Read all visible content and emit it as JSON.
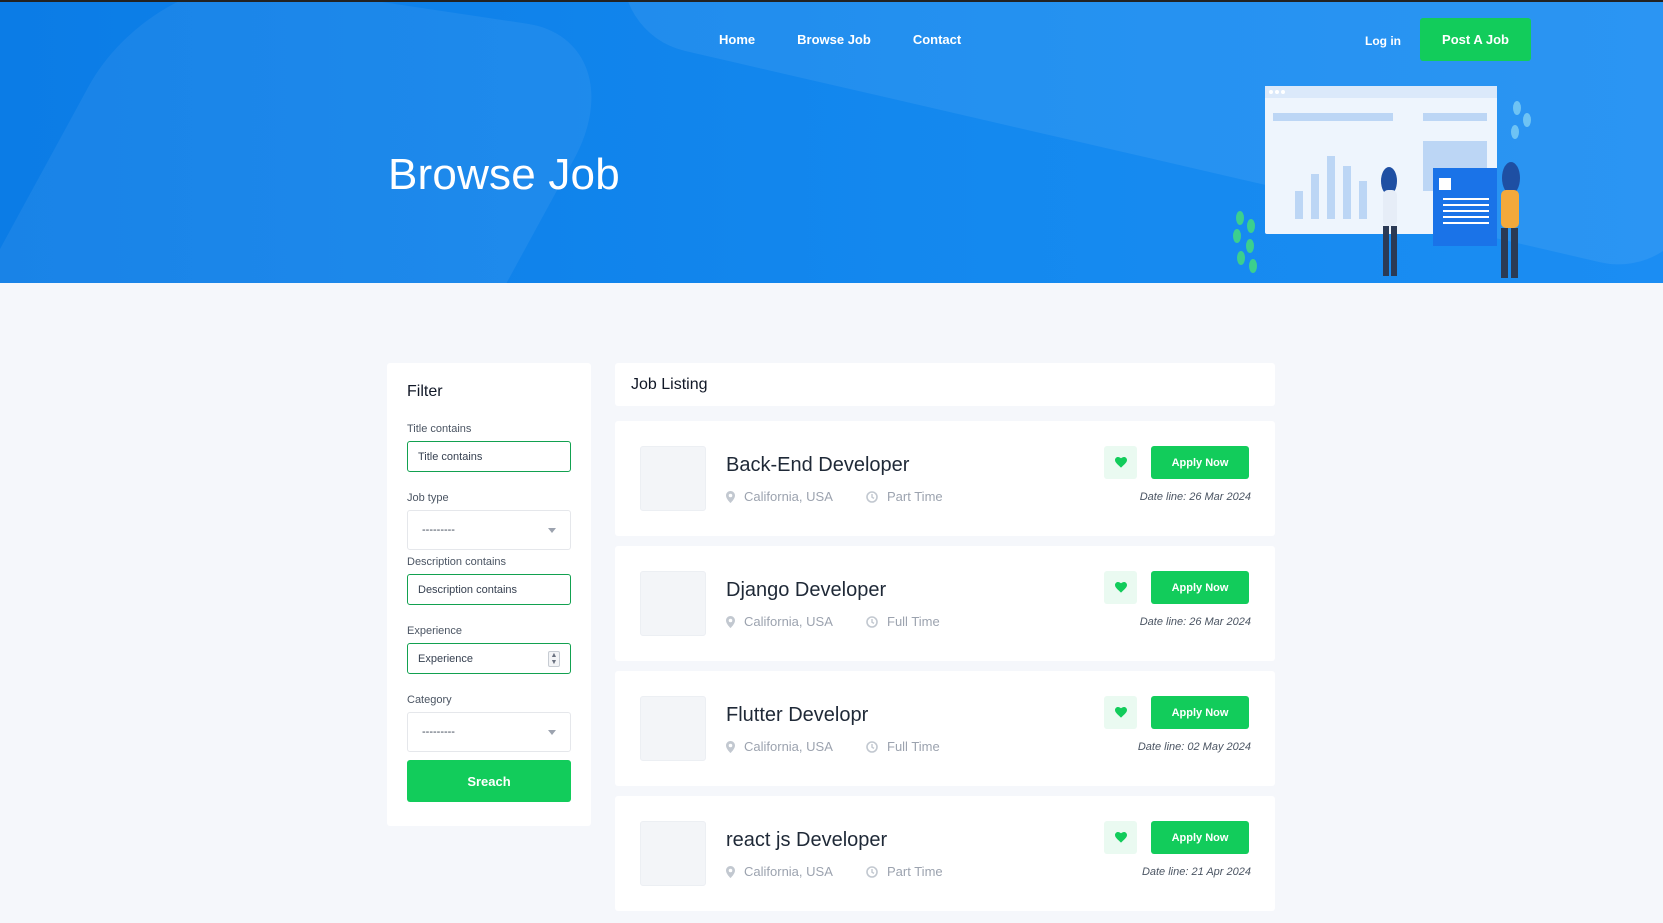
{
  "nav": {
    "items": [
      {
        "label": "Home"
      },
      {
        "label": "Browse Job"
      },
      {
        "label": "Contact"
      }
    ],
    "login_label": "Log in",
    "post_job_label": "Post A Job"
  },
  "hero": {
    "title": "Browse Job"
  },
  "filter": {
    "heading": "Filter",
    "title_label": "Title contains",
    "title_placeholder": "Title contains",
    "job_type_label": "Job type",
    "job_type_value": "---------",
    "description_label": "Description contains",
    "description_placeholder": "Description contains",
    "experience_label": "Experience",
    "experience_placeholder": "Experience",
    "category_label": "Category",
    "category_value": "---------",
    "search_label": "Sreach"
  },
  "listing": {
    "heading": "Job Listing",
    "apply_label": "Apply Now",
    "jobs": [
      {
        "title": "Back-End Developer",
        "location": "California, USA",
        "type": "Part Time",
        "deadline": "Date line: 26 Mar 2024"
      },
      {
        "title": "Django Developer",
        "location": "California, USA",
        "type": "Full Time",
        "deadline": "Date line: 26 Mar 2024"
      },
      {
        "title": "Flutter Developr",
        "location": "California, USA",
        "type": "Full Time",
        "deadline": "Date line: 02 May 2024"
      },
      {
        "title": "react js Developer",
        "location": "California, USA",
        "type": "Part Time",
        "deadline": "Date line: 21 Apr 2024"
      }
    ]
  },
  "colors": {
    "hero_blue": "#1489ef",
    "accent_green": "#12cc5b",
    "page_bg": "#f5f7fb"
  },
  "icons": [
    "location-pin-icon",
    "clock-icon",
    "heart-icon",
    "chevron-down-icon",
    "spinner-arrows-icon"
  ]
}
